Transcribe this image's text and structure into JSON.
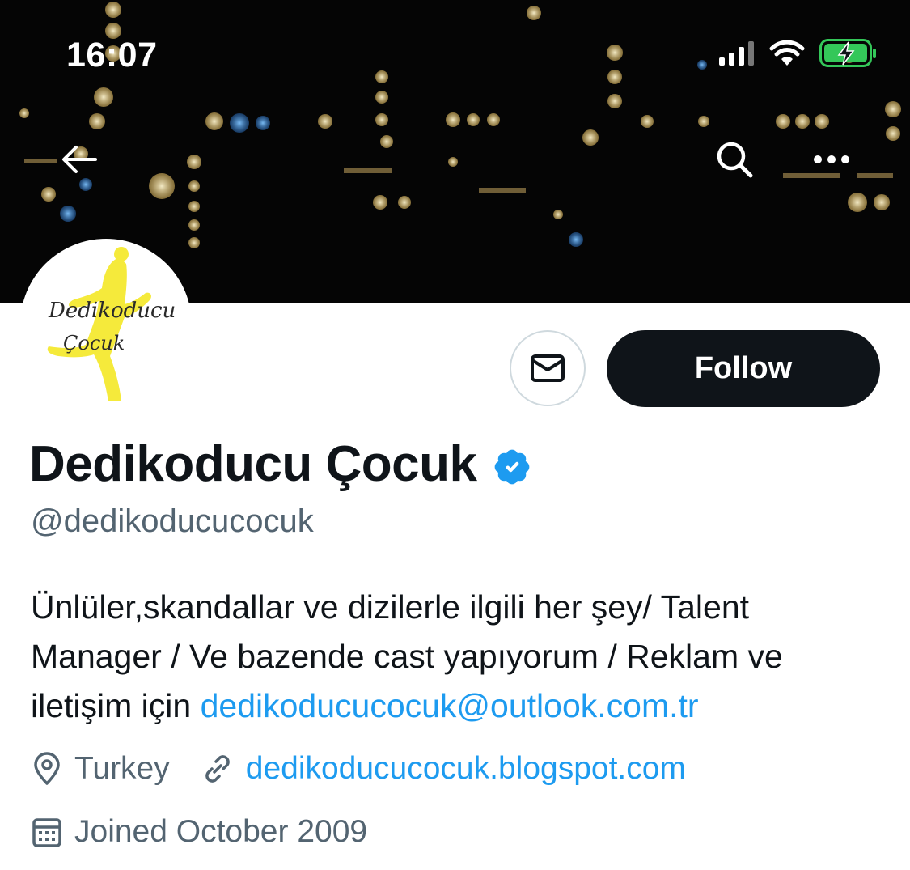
{
  "status_bar": {
    "time": "16:07",
    "icons": [
      "signal-icon",
      "wifi-icon",
      "battery-charging-icon"
    ],
    "battery_color": "#34c759"
  },
  "nav": {
    "icons": [
      "back-arrow-icon",
      "search-icon",
      "more-icon"
    ]
  },
  "avatar": {
    "logo_line1": "Dedikoducu",
    "logo_line2": "Çocuk",
    "accent": "#f5ea3b"
  },
  "actions": {
    "message_icon": "mail-icon",
    "follow_label": "Follow"
  },
  "profile": {
    "display_name": "Dedikoducu Çocuk",
    "verified": true,
    "verified_color": "#1d9bf0",
    "handle": "@dedikoducucocuk",
    "bio_text": "Ünlüler,skandallar ve dizilerle ilgili her şey/ Talent Manager / Ve bazende cast yapıyorum / Reklam ve iletişim için ",
    "bio_email": "dedikoducucocuk@outlook.com.tr",
    "location": "Turkey",
    "website": "dedikoducucocuk.blogspot.com",
    "joined": "Joined October 2009"
  },
  "colors": {
    "link": "#1d9bf0",
    "secondary_text": "#536471",
    "primary_text": "#0f1419",
    "banner": "#050505"
  }
}
